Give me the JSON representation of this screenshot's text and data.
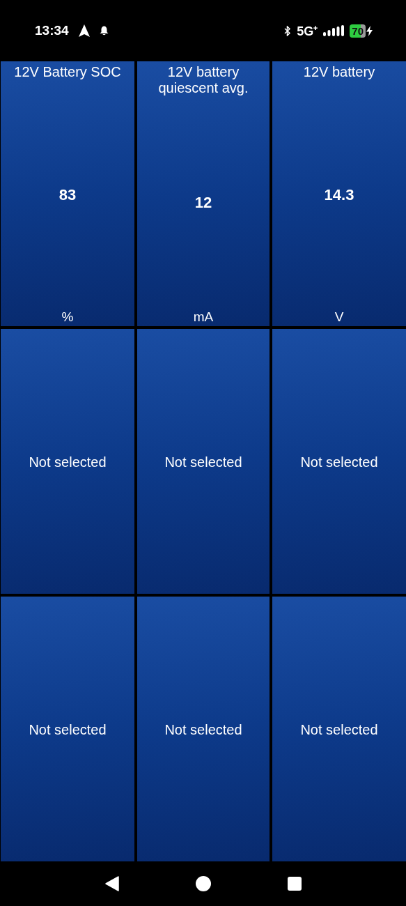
{
  "status_bar": {
    "time": "13:34",
    "network": "5G⁺",
    "battery": "70"
  },
  "tiles": [
    {
      "kind": "metric",
      "title": "12V Battery SOC",
      "value": "83",
      "unit": "%"
    },
    {
      "kind": "metric",
      "title": "12V battery quiescent avg.",
      "value": "12",
      "unit": "mA"
    },
    {
      "kind": "metric",
      "title": "12V battery",
      "value": "14.3",
      "unit": "V"
    },
    {
      "kind": "empty",
      "label": "Not selected"
    },
    {
      "kind": "empty",
      "label": "Not selected"
    },
    {
      "kind": "empty",
      "label": "Not selected"
    },
    {
      "kind": "empty",
      "label": "Not selected"
    },
    {
      "kind": "empty",
      "label": "Not selected"
    },
    {
      "kind": "empty",
      "label": "Not selected"
    }
  ]
}
